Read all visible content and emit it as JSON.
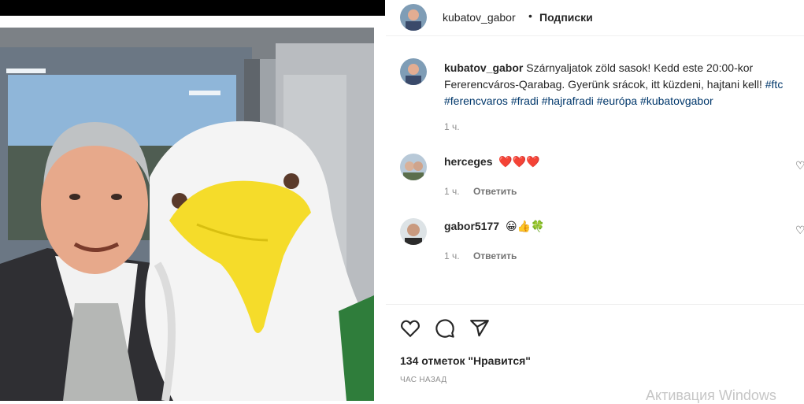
{
  "post": {
    "username": "kubatov_gabor",
    "separator": "•",
    "follow_label": "Подписки"
  },
  "caption": {
    "username": "kubatov_gabor",
    "text": "Szárnyaljatok zöld sasok! Kedd este 20:00-kor Fererencváros-Qarabag. Gyerünk srácok, itt küzdeni, hajtani kell!",
    "hashtags": "#ftc #ferencvaros #fradi #hajrafradi #európa #kubatovgabor",
    "time": "1 ч."
  },
  "comments": [
    {
      "username": "herceges",
      "text": "❤️❤️❤️",
      "time": "1 ч.",
      "reply_label": "Ответить"
    },
    {
      "username": "gabor5177",
      "text": "😀👍🍀",
      "time": "1 ч.",
      "reply_label": "Ответить"
    }
  ],
  "actions": {
    "like_icon": "heart-icon",
    "comment_icon": "comment-icon",
    "share_icon": "share-icon"
  },
  "likes_text": "134 отметок \"Нравится\"",
  "post_time": "ЧАС НАЗАД",
  "watermark": "Активация Windows",
  "photo": {
    "description_colors": {
      "jacket": "#2f2f33",
      "mascot_white": "#f4f4f4",
      "beak": "#f5dc2a"
    }
  }
}
